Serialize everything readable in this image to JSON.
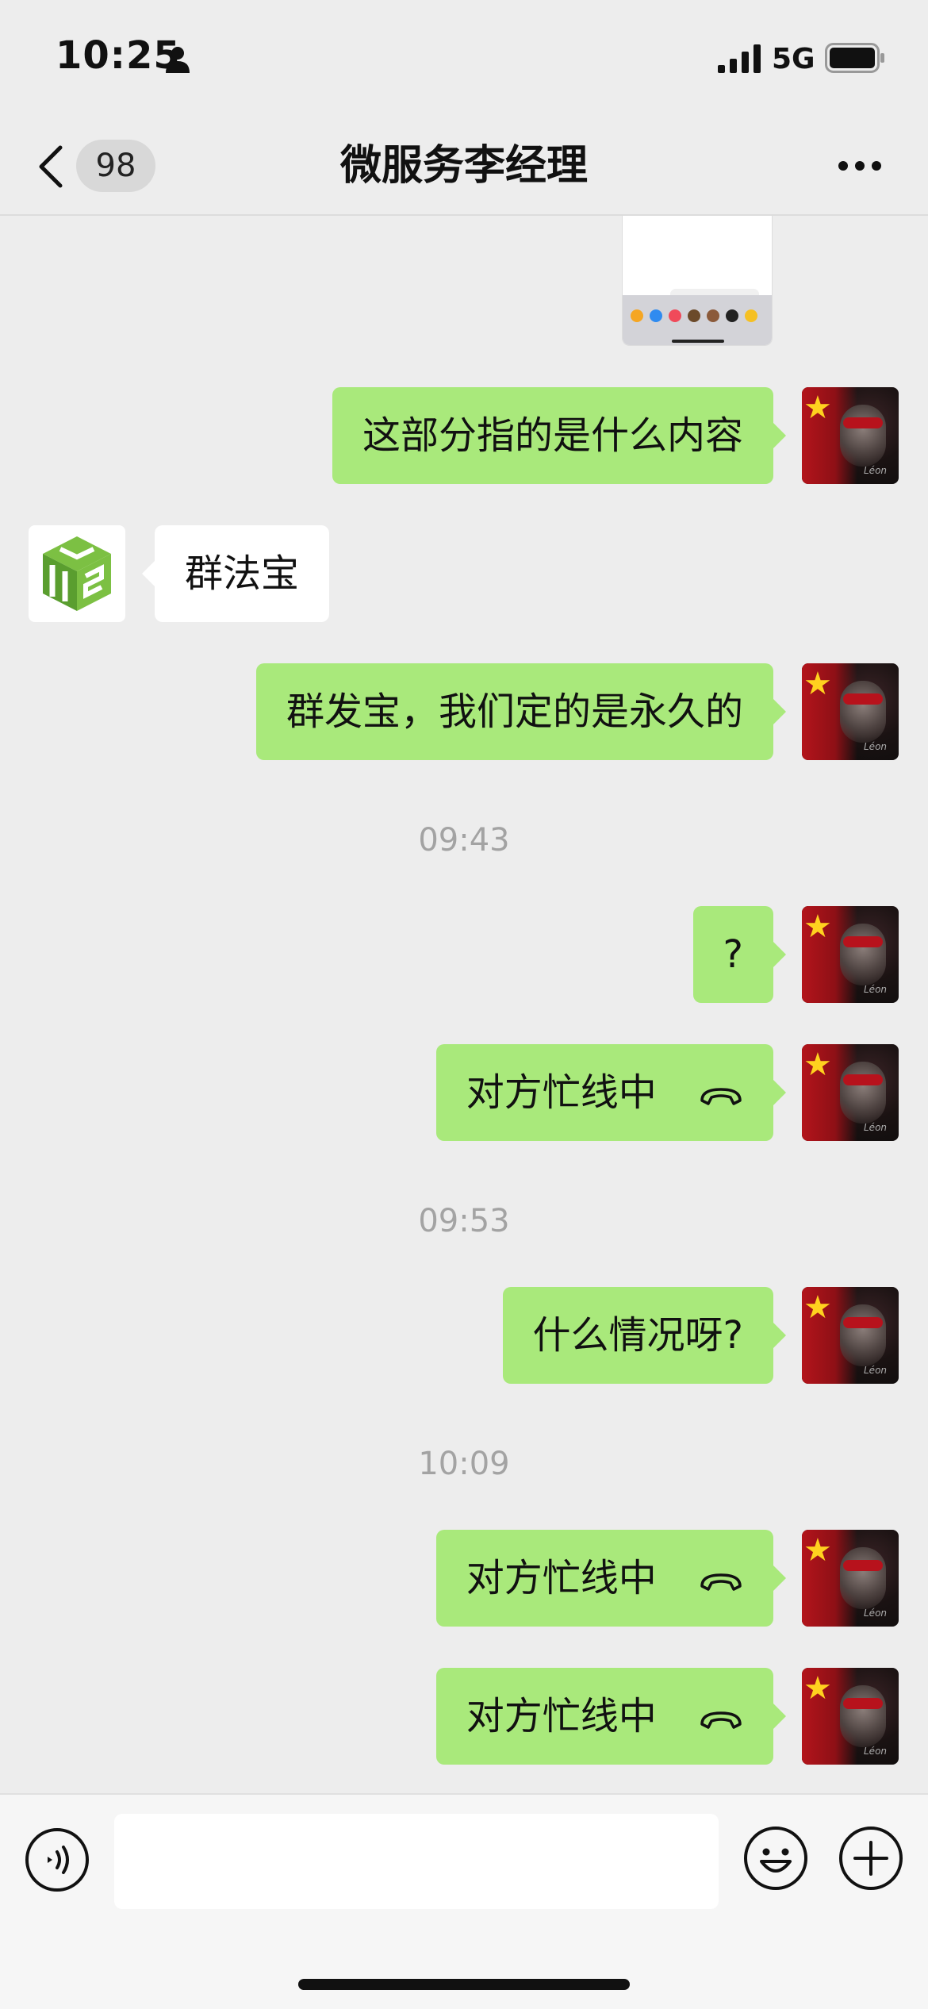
{
  "status_bar": {
    "time": "10:25",
    "network": "5G"
  },
  "nav": {
    "unread_count": "98",
    "title": "微服务李经理"
  },
  "messages": [
    {
      "id": "m1",
      "sender": "me",
      "type": "text",
      "text": "这部分指的是什么内容"
    },
    {
      "id": "m2",
      "sender": "other",
      "type": "text",
      "text": "群法宝"
    },
    {
      "id": "m3",
      "sender": "me",
      "type": "text",
      "text": "群发宝，我们定的是永久的"
    },
    {
      "id": "t1",
      "type": "timestamp",
      "text": "09:43"
    },
    {
      "id": "m4",
      "sender": "me",
      "type": "text",
      "text": "?"
    },
    {
      "id": "m5",
      "sender": "me",
      "type": "call",
      "text": "对方忙线中"
    },
    {
      "id": "t2",
      "type": "timestamp",
      "text": "09:53"
    },
    {
      "id": "m6",
      "sender": "me",
      "type": "text",
      "text": "什么情况呀?"
    },
    {
      "id": "t3",
      "type": "timestamp",
      "text": "10:09"
    },
    {
      "id": "m7",
      "sender": "me",
      "type": "call",
      "text": "对方忙线中"
    },
    {
      "id": "m8",
      "sender": "me",
      "type": "call",
      "text": "对方忙线中"
    }
  ],
  "colors": {
    "bubble_me": "#a9e97b",
    "bubble_other": "#ffffff",
    "background": "#ededed",
    "timestamp": "#a3a3a3"
  },
  "icons": [
    "back-chevron",
    "more-dots",
    "hang-up-phone",
    "voice",
    "emoji",
    "plus"
  ]
}
